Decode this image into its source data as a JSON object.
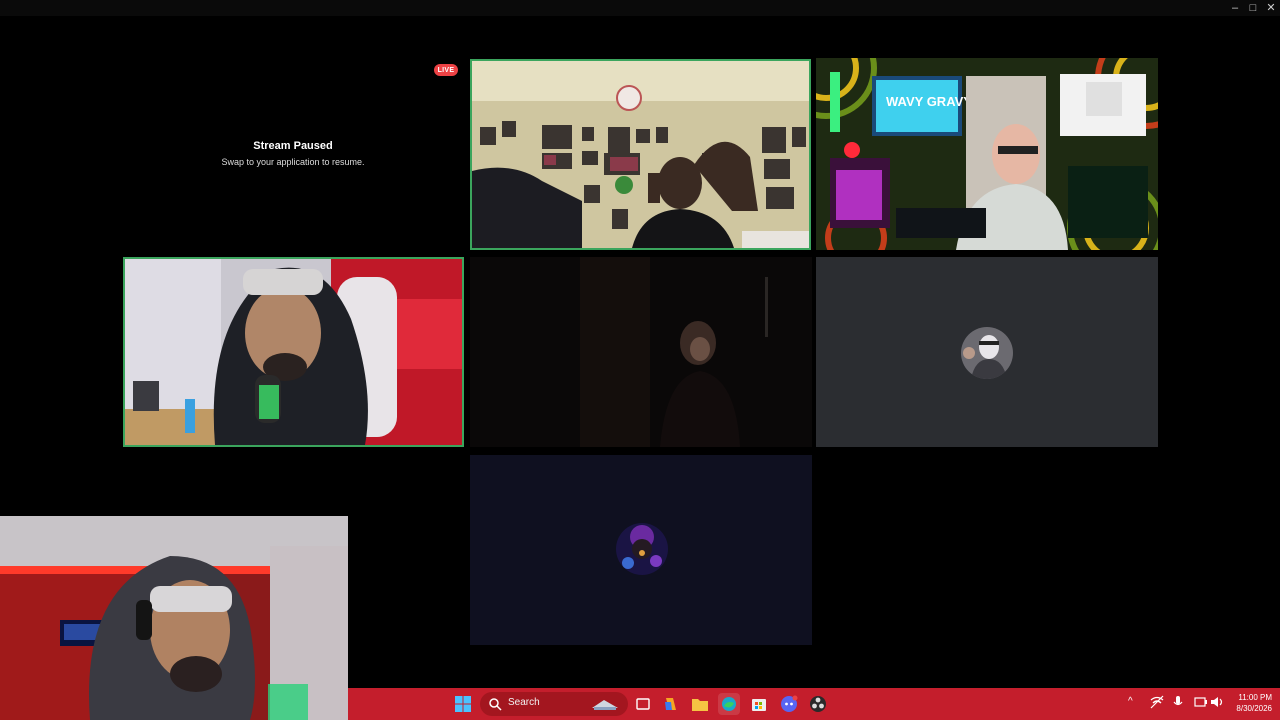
{
  "window": {
    "controls": {
      "minimize": "–",
      "maximize": "□",
      "close": "✕"
    }
  },
  "stage": {
    "paused_title": "Stream Paused",
    "paused_subtitle": "Swap to your application to resume.",
    "live_badge": "LIVE",
    "poster_text": "WAVY GRAVY"
  },
  "taskbar": {
    "search_label": "Search",
    "tray_chevron": "^",
    "time": "11:00 PM",
    "date": "8/30/2026"
  },
  "colors": {
    "speaking_border": "#3ba55d",
    "live_red": "#ed4245",
    "taskbar": "#c41e2c",
    "stage_bg": "#000000",
    "empty_tile": "#2b2d31"
  },
  "icons": [
    "windows-start-icon",
    "search-icon",
    "task-view-icon",
    "copilot-icon",
    "file-explorer-icon",
    "edge-browser-icon",
    "store-icon",
    "discord-icon",
    "obs-icon",
    "chevron-up-icon",
    "network-icon",
    "microphone-icon",
    "volume-icon",
    "battery-icon"
  ]
}
